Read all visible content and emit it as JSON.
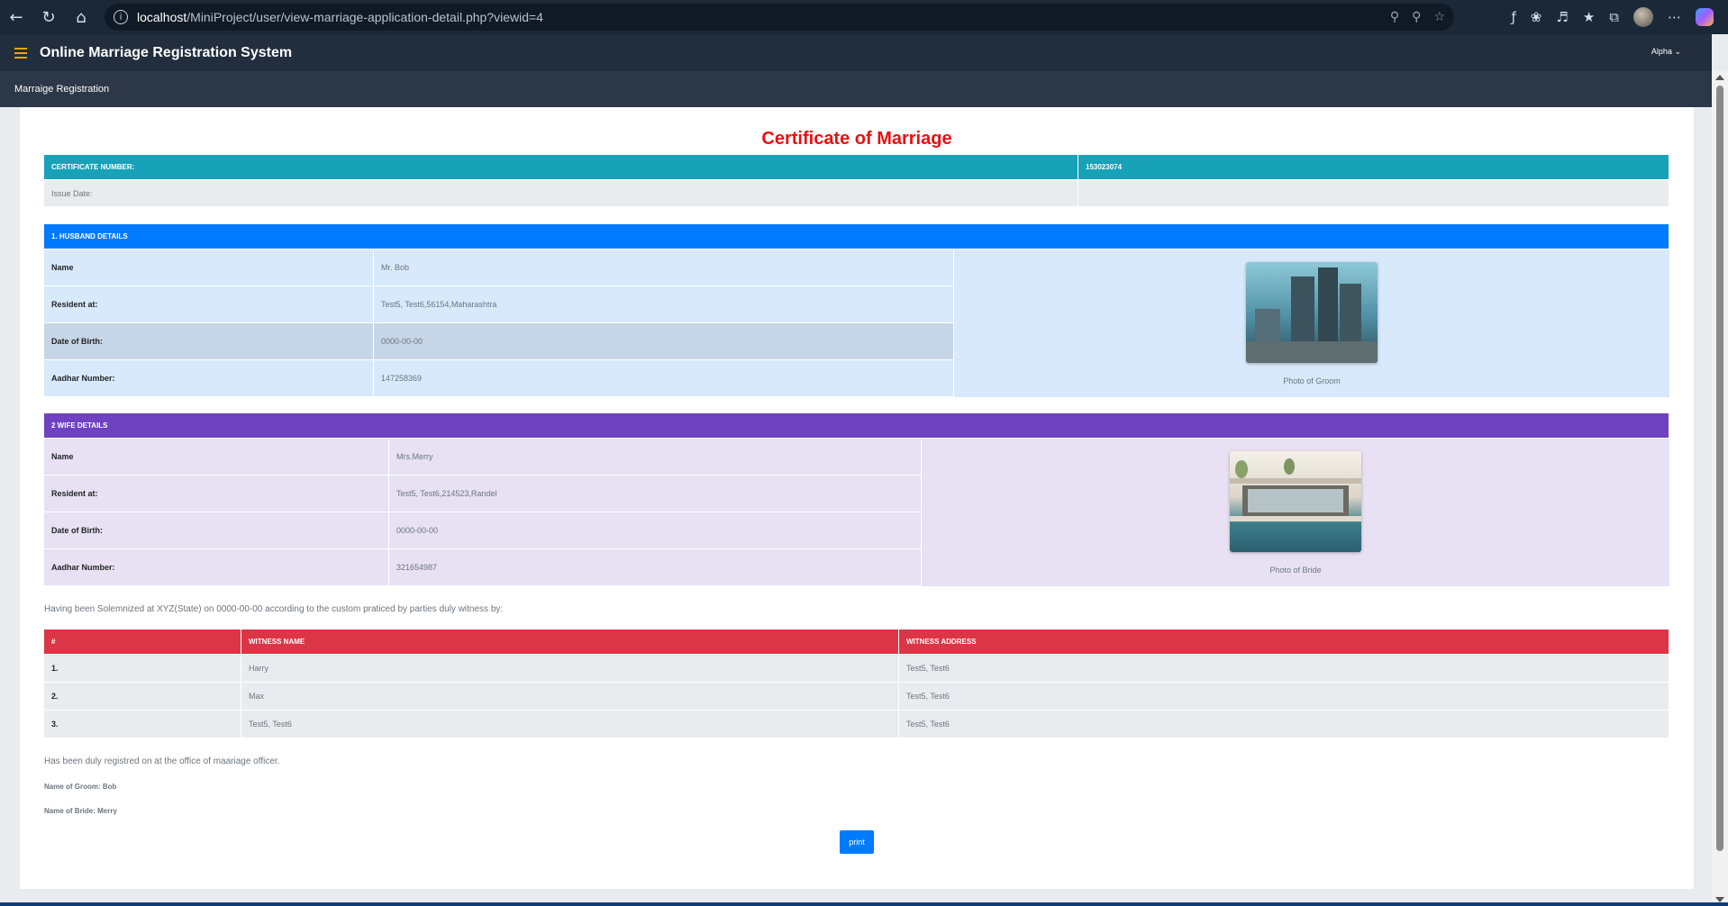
{
  "browser": {
    "url_host": "localhost",
    "url_path": "/MiniProject/user/view-marriage-application-detail.php?viewid=4"
  },
  "app": {
    "title": "Online Marriage Registration System",
    "user": "Alpha",
    "page_title": "Marraige Registration"
  },
  "certificate": {
    "title": "Certificate of Marriage",
    "number_label": "CERTIFICATE NUMBER:",
    "number": "153023074",
    "issue_label": "Issue Date:",
    "issue_date": ""
  },
  "husband": {
    "header": "1. HUSBAND DETAILS",
    "name_label": "Name",
    "name": "Mr. Bob",
    "address_label": "Resident at:",
    "address": "Test5, Test6,56154,Maharashtra",
    "dob_label": "Date of Birth:",
    "dob": "0000-00-00",
    "aadhar_label": "Aadhar Number:",
    "aadhar": "147258369",
    "photo_caption": "Photo of Groom"
  },
  "wife": {
    "header": "2 WIFE DETAILS",
    "name_label": "Name",
    "name": "Mrs.Merry",
    "address_label": "Resident at:",
    "address": "Test5, Test6,214523,Randel",
    "dob_label": "Date of Birth:",
    "dob": "0000-00-00",
    "aadhar_label": "Aadhar Number:",
    "aadhar": "321654987",
    "photo_caption": "Photo of Bride"
  },
  "solemnized_text": "Having been Solemnized at XYZ(State) on 0000-00-00 according to the custom praticed by parties duly witness by:",
  "witnesses": {
    "col_num": "#",
    "col_name": "WITNESS NAME",
    "col_address": "WITNESS ADDRESS",
    "rows": [
      {
        "num": "1.",
        "name": "Harry",
        "address": "Test5, Test6"
      },
      {
        "num": "2.",
        "name": "Max",
        "address": "Test5, Test6"
      },
      {
        "num": "3.",
        "name": "Test5, Test6",
        "address": "Test5, Test6"
      }
    ]
  },
  "registered_text": "Has been duly registred on at the office of maariage officer.",
  "groom_name_line": "Name of Groom: Bob",
  "bride_name_line": "Name of Bride: Merry",
  "print_label": "print",
  "colors": {
    "title_red": "#e8100f",
    "teal": "#17a2b8",
    "blue": "#007bff",
    "purple": "#6f42c1",
    "red": "#dc3545"
  }
}
